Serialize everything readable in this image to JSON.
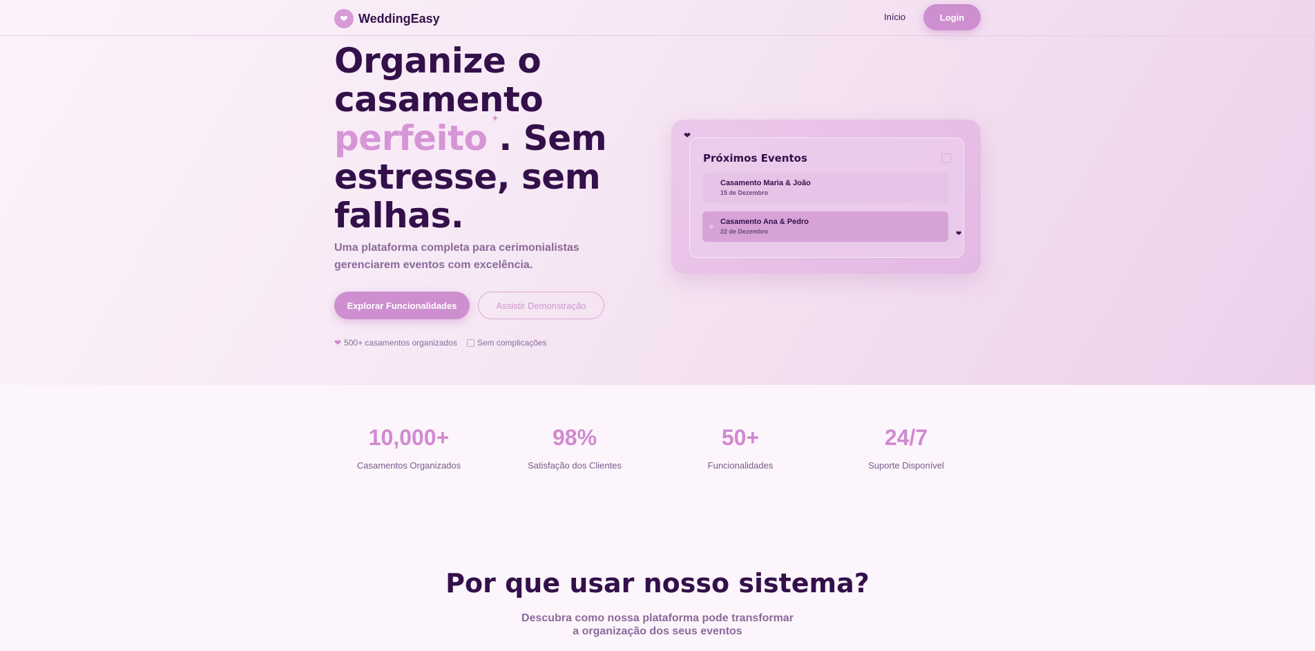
{
  "header": {
    "brand": "WeddingEasy",
    "nav_inicio": "Início",
    "login": "Login"
  },
  "hero": {
    "headline_part1": "Organize o casamento",
    "headline_highlight": "perfeito",
    "headline_part2": ". Sem estresse, sem falhas.",
    "subtitle": "Uma plataforma completa para cerimonialistas gerenciarem eventos com excelência.",
    "primary_button": "Explorar Funcionalidades",
    "secondary_button": "Assistir Demonstração",
    "tags": [
      "500+ casamentos organizados",
      "Sem complicações"
    ]
  },
  "events_card": {
    "title": "Próximos Eventos",
    "events": [
      {
        "name": "Casamento Maria & João",
        "date": "15 de Dezembro"
      },
      {
        "name": "Casamento Ana & Pedro",
        "date": "22 de Dezembro"
      }
    ]
  },
  "stats": [
    {
      "value": "10,000+",
      "label": "Casamentos Organizados"
    },
    {
      "value": "98%",
      "label": "Satisfação dos Clientes"
    },
    {
      "value": "50+",
      "label": "Funcionalidades"
    },
    {
      "value": "24/7",
      "label": "Suporte Disponível"
    }
  ],
  "why": {
    "title": "Por que usar nosso sistema?",
    "subtitle": "Descubra como nossa plataforma pode transformar a organização dos seus eventos"
  },
  "colors": {
    "accent": "#cd8fcf",
    "heading": "#33104a",
    "muted": "#8a6a9a"
  },
  "icons": [
    "heart-icon",
    "calendar-icon",
    "sparkle-icon"
  ]
}
